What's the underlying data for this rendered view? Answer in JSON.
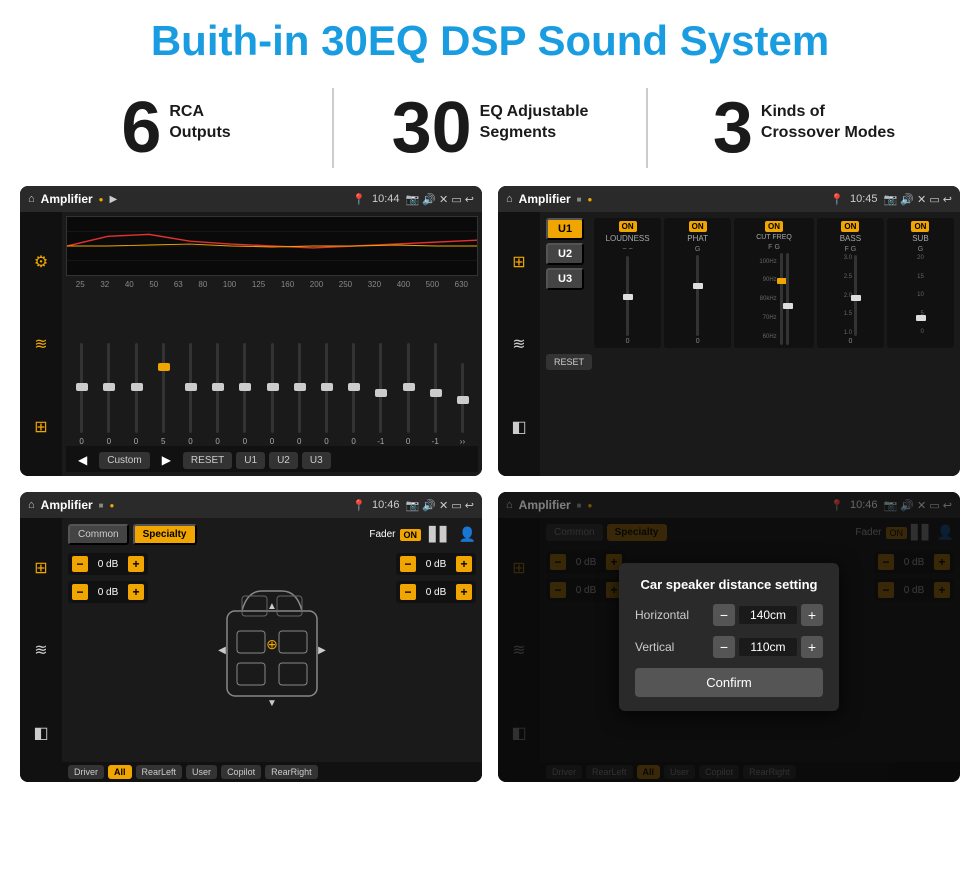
{
  "title": "Buith-in 30EQ DSP Sound System",
  "stats": [
    {
      "number": "6",
      "label": "RCA\nOutputs"
    },
    {
      "number": "30",
      "label": "EQ Adjustable\nSegments"
    },
    {
      "number": "3",
      "label": "Kinds of\nCrossover Modes"
    }
  ],
  "screens": [
    {
      "id": "eq-screen",
      "status_bar": {
        "home": "⌂",
        "app_name": "Amplifier",
        "dots": "● ▶",
        "pin": "📍",
        "time": "10:44",
        "icons": "📷 🔊 ✕ ▭ ↩"
      },
      "frequencies": [
        "25",
        "32",
        "40",
        "50",
        "63",
        "80",
        "100",
        "125",
        "160",
        "200",
        "250",
        "320",
        "400",
        "500",
        "630"
      ],
      "values": [
        "0",
        "0",
        "0",
        "5",
        "0",
        "0",
        "0",
        "0",
        "0",
        "0",
        "0",
        "-1",
        "0",
        "-1"
      ],
      "presets": [
        "Custom",
        "RESET",
        "U1",
        "U2",
        "U3"
      ]
    },
    {
      "id": "crossover-screen",
      "status_bar": {
        "app_name": "Amplifier",
        "time": "10:45"
      },
      "tabs": [
        "U1",
        "U2",
        "U3"
      ],
      "channels": [
        {
          "label": "LOUDNESS",
          "on": true
        },
        {
          "label": "PHAT",
          "on": true
        },
        {
          "label": "CUT FREQ",
          "on": true
        },
        {
          "label": "BASS",
          "on": true
        },
        {
          "label": "SUB",
          "on": true
        }
      ],
      "reset_label": "RESET"
    },
    {
      "id": "speaker-screen",
      "status_bar": {
        "app_name": "Amplifier",
        "time": "10:46"
      },
      "tabs": [
        "Common",
        "Specialty"
      ],
      "fader_label": "Fader",
      "fader_on": true,
      "db_controls_left": [
        "0 dB",
        "0 dB"
      ],
      "db_controls_right": [
        "0 dB",
        "0 dB"
      ],
      "bottom_buttons": [
        "Driver",
        "RearLeft",
        "All",
        "User",
        "Copilot",
        "RearRight"
      ]
    },
    {
      "id": "distance-screen",
      "status_bar": {
        "app_name": "Amplifier",
        "time": "10:46"
      },
      "tabs": [
        "Common",
        "Specialty"
      ],
      "dialog": {
        "title": "Car speaker distance setting",
        "fields": [
          {
            "label": "Horizontal",
            "value": "140cm"
          },
          {
            "label": "Vertical",
            "value": "110cm"
          }
        ],
        "confirm_label": "Confirm"
      },
      "db_controls_right": [
        "0 dB",
        "0 dB"
      ],
      "bottom_buttons": [
        "Driver",
        "RearLeft",
        "All",
        "Copilot",
        "RearRight"
      ]
    }
  ],
  "colors": {
    "accent": "#1a9de0",
    "orange": "#f0a500",
    "dark_bg": "#1a1a1a",
    "darker_bg": "#111111"
  }
}
